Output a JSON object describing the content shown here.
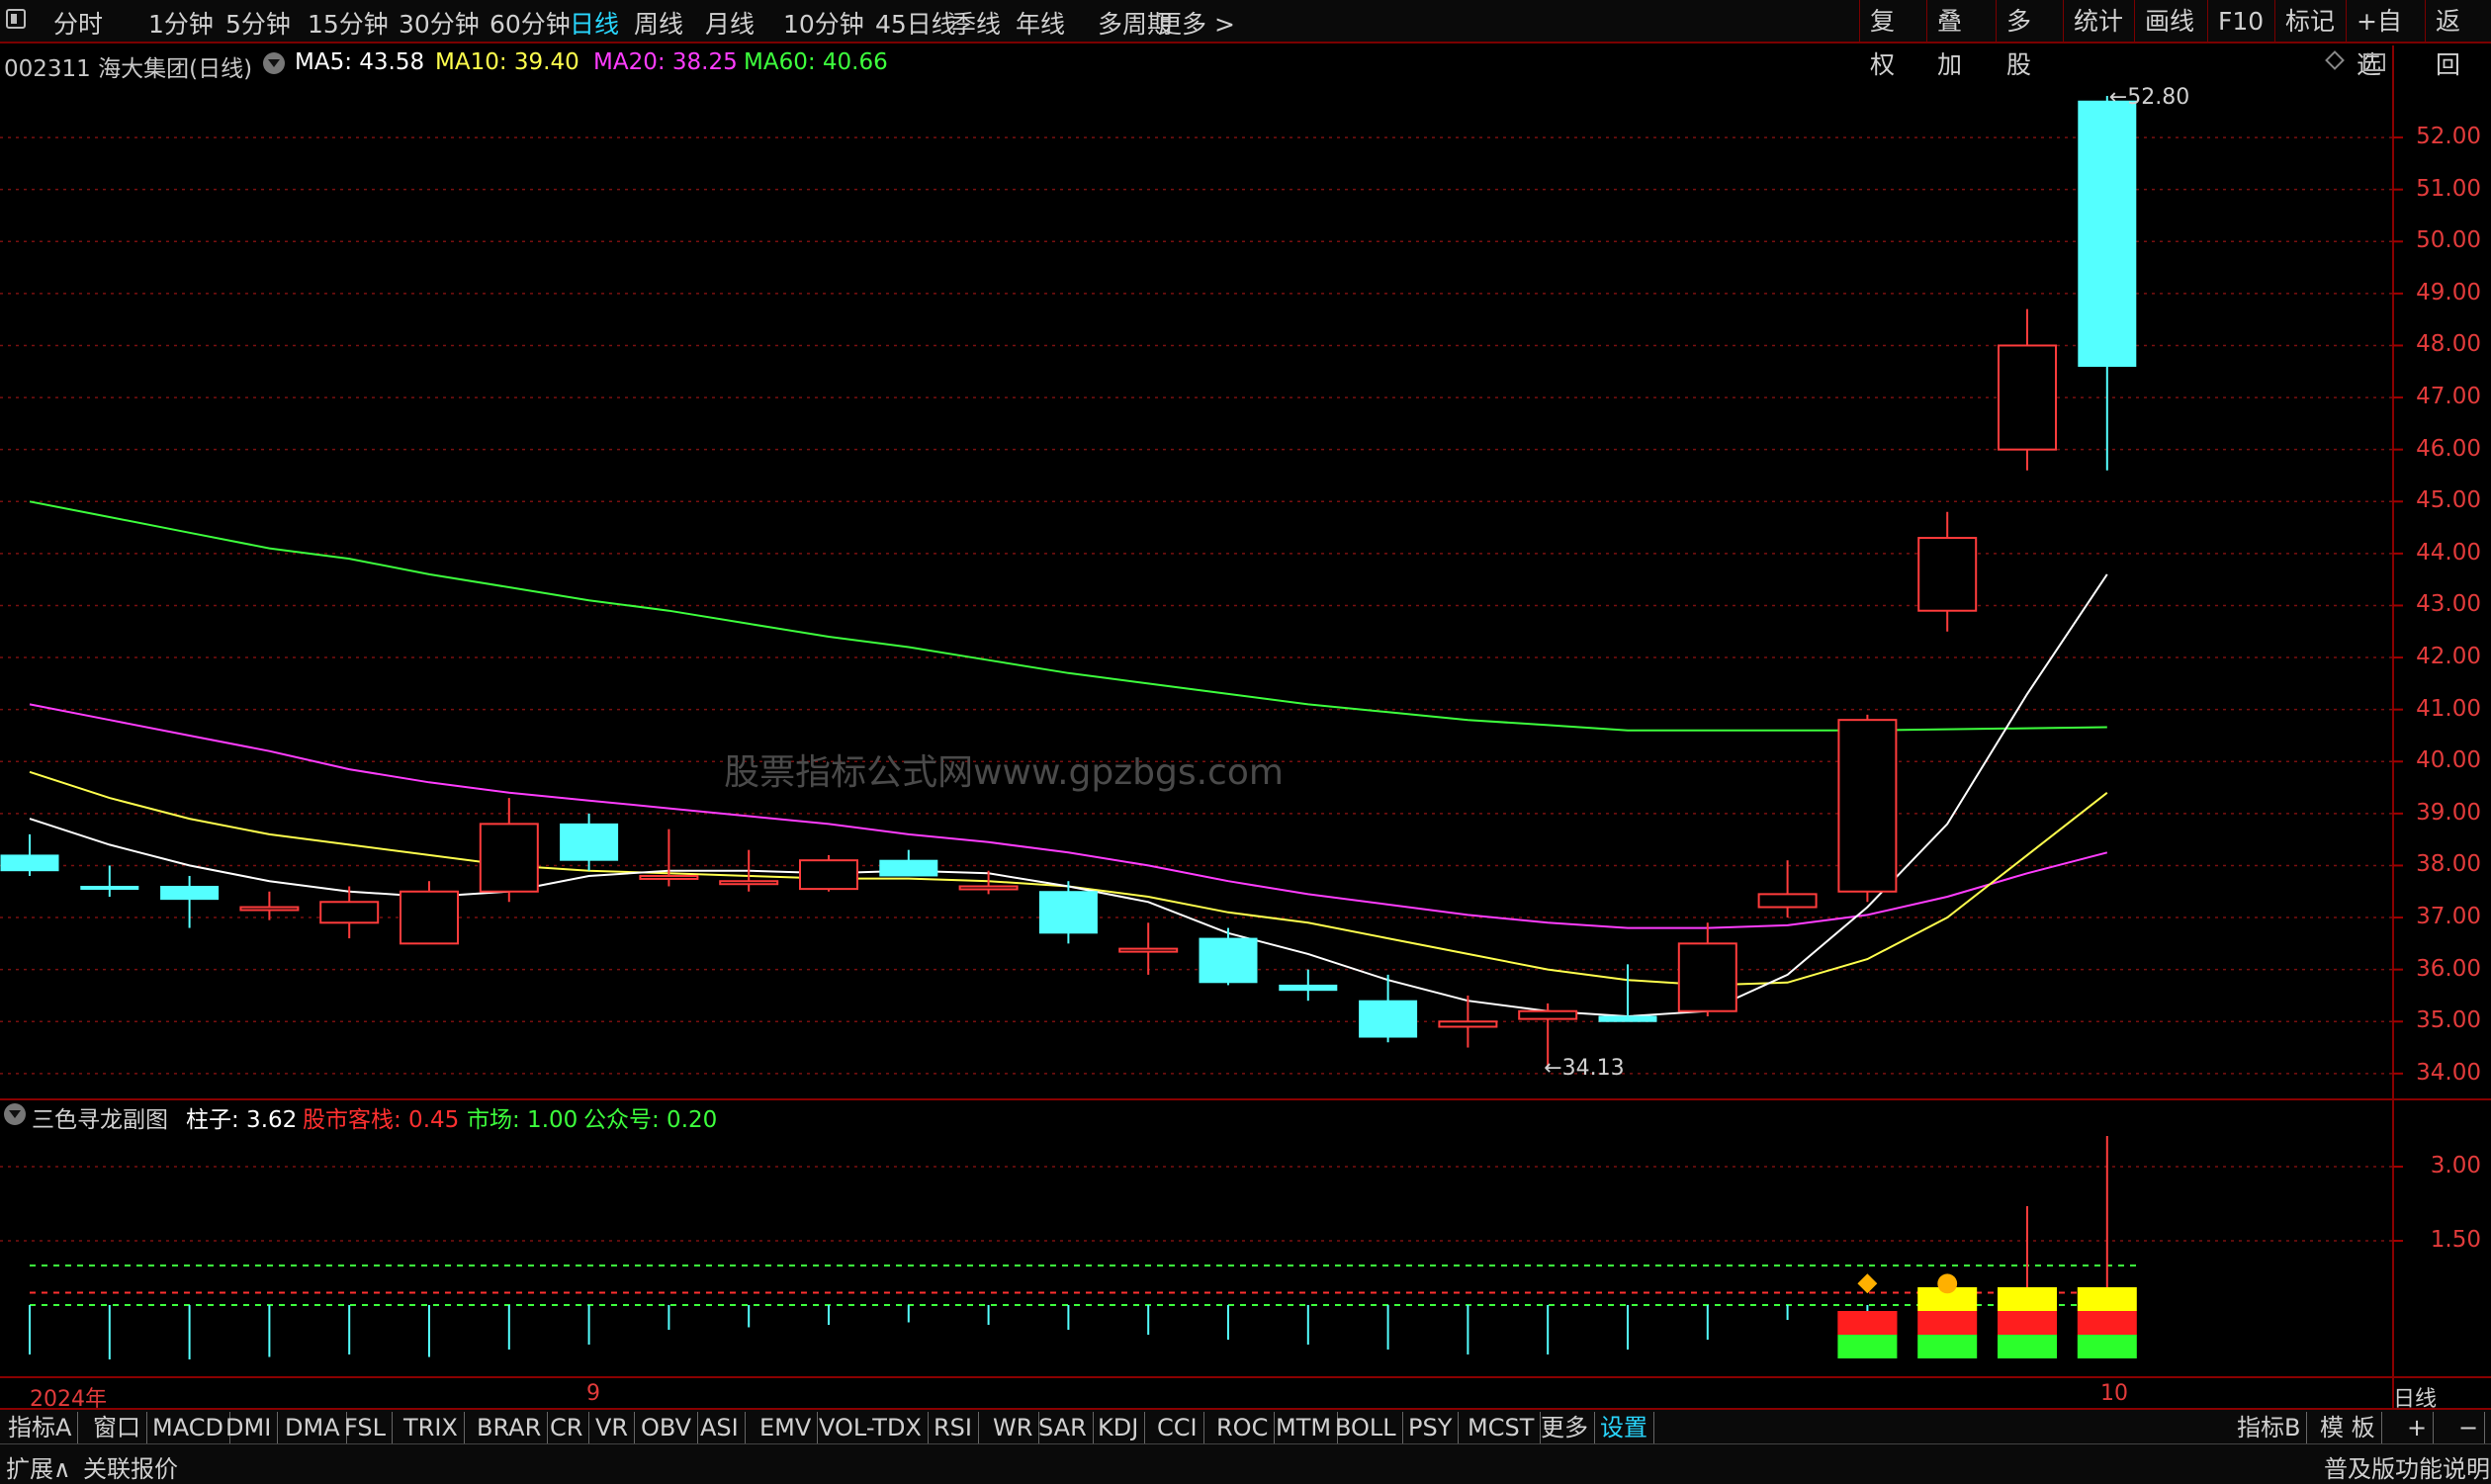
{
  "toolbar": {
    "icon": "panel-toggle-icon",
    "periods": [
      "分时",
      "1分钟",
      "5分钟",
      "15分钟",
      "30分钟",
      "60分钟",
      "日线",
      "周线",
      "月线",
      "10分钟",
      "45日线",
      "季线",
      "年线",
      "多周期",
      "更多 >"
    ],
    "active_period": "日线",
    "right_buttons": [
      "复权",
      "叠加",
      "多股",
      "统计",
      "画线",
      "F10",
      "标记",
      "+自选",
      "返回"
    ]
  },
  "main_chart": {
    "title": "002311 海大集团(日线)",
    "ma": [
      {
        "label": "MA5: 43.58",
        "color": "#ffffff"
      },
      {
        "label": "MA10: 39.40",
        "color": "#ffff4d"
      },
      {
        "label": "MA20: 38.25",
        "color": "#ff3dff"
      },
      {
        "label": "MA60: 40.66",
        "color": "#3dff3d"
      }
    ],
    "watermark": "股票指标公式网www.gpzbgs.com",
    "high_marker": "52.80",
    "low_marker": "34.13",
    "price_axis": [
      "52.00",
      "51.00",
      "50.00",
      "49.00",
      "48.00",
      "47.00",
      "46.00",
      "45.00",
      "44.00",
      "43.00",
      "42.00",
      "41.00",
      "40.00",
      "39.00",
      "38.00",
      "37.00",
      "36.00",
      "35.00",
      "34.00"
    ]
  },
  "sub_chart": {
    "title": "三色寻龙副图",
    "values": [
      {
        "label": "柱子: 3.62",
        "color": "#ffffff"
      },
      {
        "label": "股市客栈: 0.45",
        "color": "#ff3030"
      },
      {
        "label": "市场: 1.00",
        "color": "#3dff3d"
      },
      {
        "label": "公众号: 0.20",
        "color": "#3dff3d"
      }
    ],
    "axis": [
      "3.00",
      "1.50"
    ]
  },
  "time_axis": {
    "year": "2024年",
    "month1": "9",
    "month2": "10",
    "right": "日线"
  },
  "indicator_tabs": [
    "指标A",
    "窗口",
    "MACD",
    "DMI",
    "DMA",
    "FSL",
    "TRIX",
    "BRAR",
    "CR",
    "VR",
    "OBV",
    "ASI",
    "EMV",
    "VOL-TDX",
    "RSI",
    "WR",
    "SAR",
    "KDJ",
    "CCI",
    "ROC",
    "MTM",
    "BOLL",
    "PSY",
    "MCST",
    "更多",
    "设置"
  ],
  "indicator_right": [
    "指标B",
    "模 板",
    "+",
    "−"
  ],
  "status": {
    "left1": "扩展∧",
    "left2": "关联报价",
    "right": "普及版功能说明"
  },
  "chart_data": {
    "type": "candlestick",
    "title": "002311 海大集团(日线)",
    "ylim": [
      33.4,
      53.5
    ],
    "candles": [
      {
        "o": 38.2,
        "h": 38.6,
        "l": 37.8,
        "c": 37.9
      },
      {
        "o": 37.6,
        "h": 38.0,
        "l": 37.4,
        "c": 37.55
      },
      {
        "o": 37.6,
        "h": 37.8,
        "l": 36.8,
        "c": 37.35
      },
      {
        "o": 37.2,
        "h": 37.5,
        "l": 36.95,
        "c": 37.2
      },
      {
        "o": 36.9,
        "h": 37.6,
        "l": 36.6,
        "c": 37.3
      },
      {
        "o": 36.5,
        "h": 37.7,
        "l": 36.5,
        "c": 37.5
      },
      {
        "o": 37.5,
        "h": 39.3,
        "l": 37.3,
        "c": 38.8
      },
      {
        "o": 38.8,
        "h": 39.0,
        "l": 37.9,
        "c": 38.1
      },
      {
        "o": 37.8,
        "h": 38.7,
        "l": 37.6,
        "c": 37.8
      },
      {
        "o": 37.7,
        "h": 38.3,
        "l": 37.5,
        "c": 37.7
      },
      {
        "o": 37.55,
        "h": 38.2,
        "l": 37.5,
        "c": 38.1
      },
      {
        "o": 38.1,
        "h": 38.3,
        "l": 37.8,
        "c": 37.8
      },
      {
        "o": 37.6,
        "h": 37.9,
        "l": 37.45,
        "c": 37.6
      },
      {
        "o": 37.5,
        "h": 37.7,
        "l": 36.5,
        "c": 36.7
      },
      {
        "o": 36.4,
        "h": 36.9,
        "l": 35.9,
        "c": 36.4
      },
      {
        "o": 36.6,
        "h": 36.8,
        "l": 35.7,
        "c": 35.75
      },
      {
        "o": 35.7,
        "h": 36.0,
        "l": 35.4,
        "c": 35.6
      },
      {
        "o": 35.4,
        "h": 35.9,
        "l": 34.6,
        "c": 34.7
      },
      {
        "o": 34.9,
        "h": 35.5,
        "l": 34.5,
        "c": 35.0
      },
      {
        "o": 35.05,
        "h": 35.35,
        "l": 34.13,
        "c": 35.2
      },
      {
        "o": 35.1,
        "h": 36.1,
        "l": 35.0,
        "c": 35.0
      },
      {
        "o": 35.2,
        "h": 36.9,
        "l": 35.1,
        "c": 36.5
      },
      {
        "o": 37.2,
        "h": 38.1,
        "l": 37.0,
        "c": 37.45
      },
      {
        "o": 37.5,
        "h": 40.9,
        "l": 37.3,
        "c": 40.8
      },
      {
        "o": 42.9,
        "h": 44.8,
        "l": 42.5,
        "c": 44.3
      },
      {
        "o": 46.0,
        "h": 48.7,
        "l": 45.6,
        "c": 48.0
      },
      {
        "o": 52.7,
        "h": 52.8,
        "l": 45.6,
        "c": 47.6
      }
    ],
    "ma5": [
      38.9,
      38.4,
      38.0,
      37.7,
      37.5,
      37.4,
      37.5,
      37.8,
      37.9,
      37.9,
      37.85,
      37.9,
      37.85,
      37.6,
      37.3,
      36.7,
      36.3,
      35.8,
      35.4,
      35.2,
      35.1,
      35.2,
      35.9,
      37.2,
      38.8,
      41.3,
      43.6
    ],
    "ma10": [
      39.8,
      39.3,
      38.9,
      38.6,
      38.4,
      38.2,
      38.0,
      37.9,
      37.85,
      37.8,
      37.75,
      37.75,
      37.7,
      37.6,
      37.4,
      37.1,
      36.9,
      36.6,
      36.3,
      36.0,
      35.8,
      35.7,
      35.75,
      36.2,
      37.0,
      38.2,
      39.4
    ],
    "ma20": [
      41.1,
      40.8,
      40.5,
      40.2,
      39.85,
      39.6,
      39.4,
      39.25,
      39.1,
      38.95,
      38.8,
      38.6,
      38.45,
      38.25,
      38.0,
      37.7,
      37.45,
      37.25,
      37.05,
      36.9,
      36.8,
      36.8,
      36.85,
      37.05,
      37.4,
      37.85,
      38.25
    ],
    "ma60": [
      45.0,
      44.7,
      44.4,
      44.1,
      43.9,
      43.6,
      43.35,
      43.1,
      42.9,
      42.65,
      42.4,
      42.2,
      41.95,
      41.7,
      41.5,
      41.3,
      41.1,
      40.95,
      40.8,
      40.7,
      40.6,
      40.6,
      40.6,
      40.6,
      40.62,
      40.64,
      40.66
    ],
    "sub_ylim": [
      -1.5,
      4.5
    ],
    "sub_lines": [
      {
        "name": "市场",
        "value": 1.0
      },
      {
        "name": "股市客栈",
        "value": 0.45
      },
      {
        "name": "公众号",
        "value": 0.2
      }
    ],
    "sub_spikes": [
      -0.8,
      -0.9,
      -0.9,
      -0.85,
      -0.8,
      -0.85,
      -0.7,
      -0.6,
      -0.3,
      -0.25,
      -0.2,
      -0.15,
      -0.2,
      -0.3,
      -0.4,
      -0.5,
      -0.6,
      -0.7,
      -0.8,
      -0.8,
      -0.7,
      -0.5,
      -0.1,
      0.0,
      0.2,
      2.2,
      3.62
    ]
  }
}
